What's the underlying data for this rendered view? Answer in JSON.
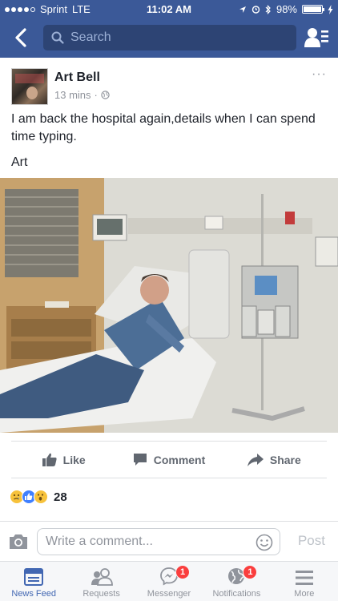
{
  "status_bar": {
    "carrier": "Sprint",
    "network": "LTE",
    "time": "11:02 AM",
    "battery": "98%"
  },
  "nav": {
    "search_placeholder": "Search"
  },
  "post": {
    "author": "Art Bell",
    "time": "13 mins",
    "separator": "·",
    "more": "···",
    "text": "I am back the hospital again,details when I can spend time typing.",
    "signature": "Art",
    "photo_icon": "photo"
  },
  "actions": {
    "like": "Like",
    "comment": "Comment",
    "share": "Share"
  },
  "reactions": {
    "count": "28",
    "types": [
      "sad",
      "like",
      "wow"
    ]
  },
  "comment_bar": {
    "placeholder": "Write a comment...",
    "post_label": "Post"
  },
  "tabs": [
    {
      "label": "News Feed",
      "icon": "news-feed-icon",
      "active": true
    },
    {
      "label": "Requests",
      "icon": "requests-icon"
    },
    {
      "label": "Messenger",
      "icon": "messenger-icon",
      "badge": "1"
    },
    {
      "label": "Notifications",
      "icon": "globe-icon",
      "badge": "1"
    },
    {
      "label": "More",
      "icon": "menu-icon"
    }
  ],
  "colors": {
    "brand": "#3b5998",
    "active_tab": "#4267b2",
    "badge": "#fa3e3e"
  }
}
